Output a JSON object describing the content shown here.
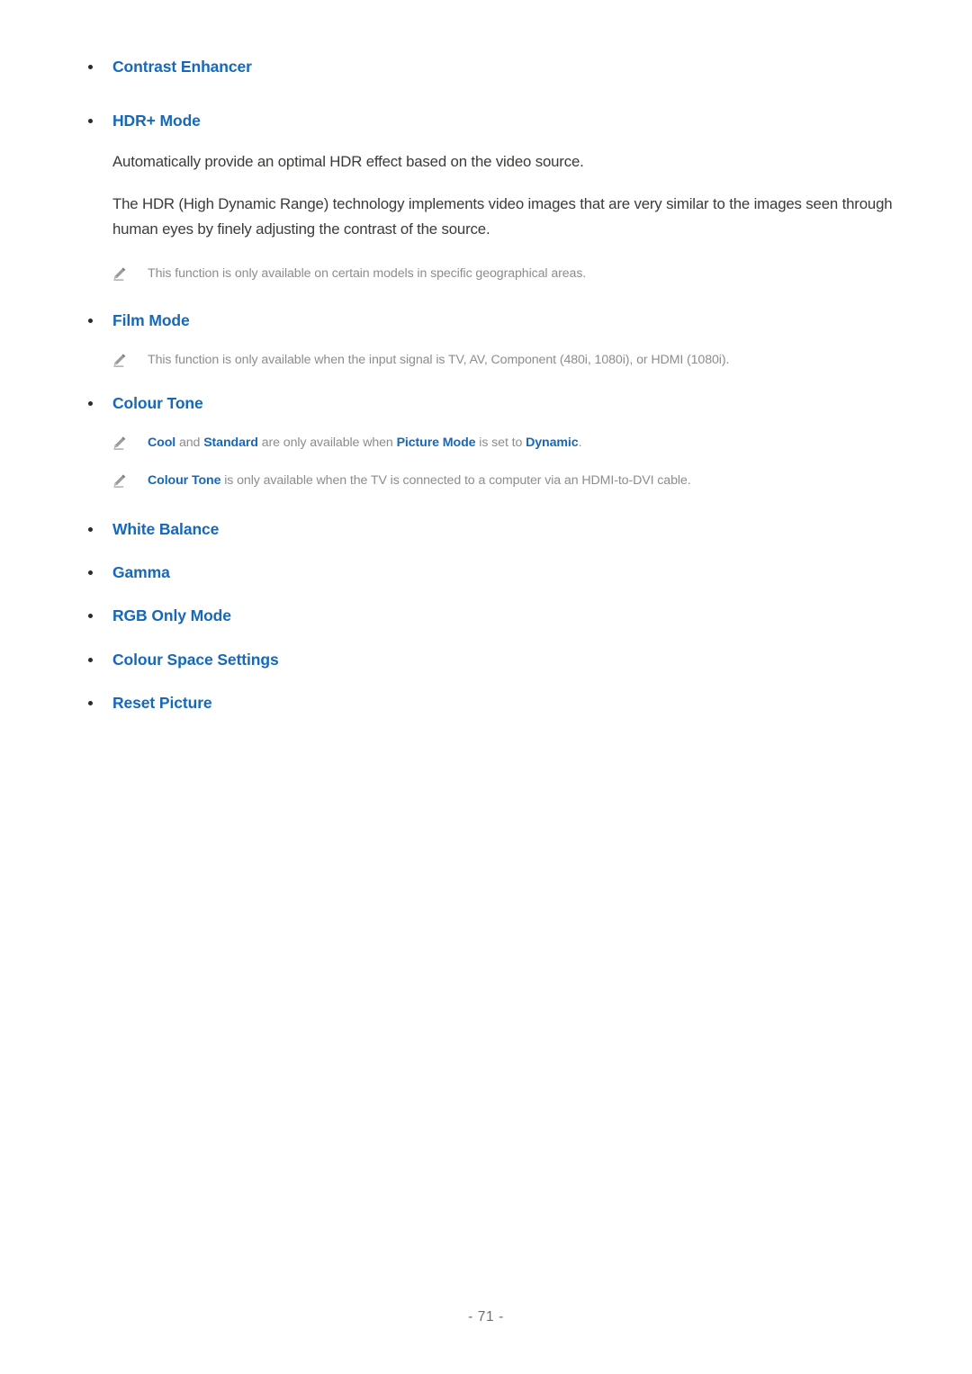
{
  "document": {
    "page_number_label": "- 71 -",
    "accent_color": "#1668b8",
    "body_text_color": "#3d3a38",
    "note_text_color": "#8e8c8c",
    "background_color": "#ffffff"
  },
  "sections": {
    "contrast_enhancer": {
      "label": "Contrast Enhancer"
    },
    "hdr_plus_mode": {
      "label": "HDR+ Mode",
      "paragraph_1": "Automatically provide an optimal HDR effect based on the video source.",
      "paragraph_2": "The HDR (High Dynamic Range) technology implements video images that are very similar to the images seen through human eyes by finely adjusting the contrast of the source.",
      "note_1": "This function is only available on certain models in specific geographical areas."
    },
    "film_mode": {
      "label": "Film Mode",
      "note_1": "This function is only available when the input signal is TV, AV, Component (480i, 1080i), or HDMI (1080i)."
    },
    "colour_tone": {
      "label": "Colour Tone",
      "note_1": {
        "part_1_keyword": "Cool",
        "part_2_plain": " and ",
        "part_3_keyword": "Standard",
        "part_4_plain": " are only available when ",
        "part_5_keyword": "Picture Mode",
        "part_6_plain": " is set to ",
        "part_7_keyword": "Dynamic",
        "part_8_plain": "."
      },
      "note_2": {
        "part_1_keyword": "Colour Tone",
        "part_2_plain": " is only available when the TV is connected to a computer via an HDMI-to-DVI cable."
      }
    },
    "white_balance": {
      "label": "White Balance"
    },
    "gamma": {
      "label": "Gamma"
    },
    "rgb_only_mode": {
      "label": "RGB Only Mode"
    },
    "colour_space_settings": {
      "label": "Colour Space Settings"
    },
    "reset_picture": {
      "label": "Reset Picture"
    }
  }
}
